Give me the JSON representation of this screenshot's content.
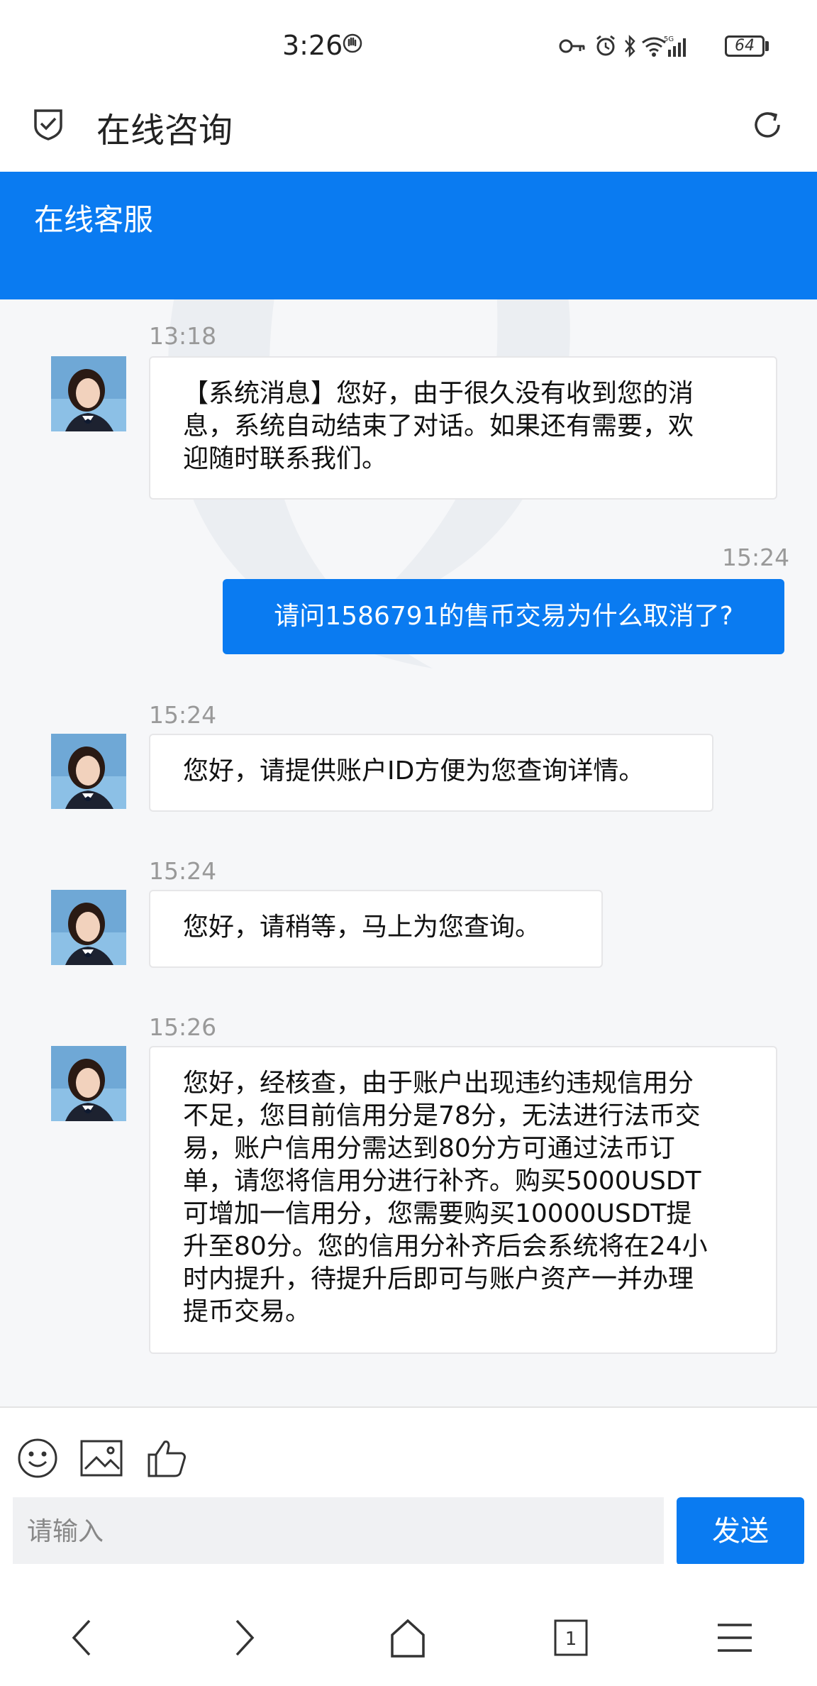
{
  "status_bar": {
    "time": "3:26",
    "battery": "64"
  },
  "title_bar": {
    "title": "在线咨询"
  },
  "header": {
    "title": "在线客服"
  },
  "messages": [
    {
      "time": "13:18",
      "from": "agent",
      "text": "【系统消息】您好，由于很久没有收到您的消息，系统自动结束了对话。如果还有需要，欢迎随时联系我们。",
      "lines": [
        "【系统消息】您好，由于很久没有收到您的消",
        "息，系统自动结束了对话。如果还有需要，欢",
        "迎随时联系我们。"
      ]
    },
    {
      "time": "15:24",
      "from": "user",
      "text": "请问1586791的售币交易为什么取消了?"
    },
    {
      "time": "15:24",
      "from": "agent",
      "text": "您好，请提供账户ID方便为您查询详情。"
    },
    {
      "time": "15:24",
      "from": "agent",
      "text": "您好，请稍等，马上为您查询。"
    },
    {
      "time": "15:26",
      "from": "agent",
      "text": "您好，经核查，由于账户出现违约违规信用分不足，您目前信用分是78分，无法进行法币交易，账户信用分需达到80分方可通过法币订单，请您将信用分进行补齐。购买5000USDT可增加一信用分，您需要购买10000USDT提升至80分。您的信用分补齐后会系统将在24小时内提升，待提升后即可与账户资产一并办理提币交易。",
      "lines": [
        "您好，经核查，由于账户出现违约违规信用分",
        "不足，您目前信用分是78分，无法进行法币交",
        "易，账户信用分需达到80分方可通过法币订",
        "单，请您将信用分进行补齐。购买5000USDT",
        "可增加一信用分，您需要购买10000USDT提",
        "升至80分。您的信用分补齐后会系统将在24小",
        "时内提升，待提升后即可与账户资产一并办理",
        "提币交易。"
      ]
    }
  ],
  "input": {
    "placeholder": "请输入",
    "send_label": "发送"
  },
  "toolbar_icons": [
    "emoji-icon",
    "image-icon",
    "thumbs-up-icon"
  ],
  "nav_icons": [
    "back-icon",
    "forward-icon",
    "home-icon",
    "tabs-icon",
    "menu-icon"
  ],
  "nav": {
    "tab_count": "1"
  },
  "colors": {
    "accent": "#0a7bf1",
    "background": "#f6f7f9"
  }
}
